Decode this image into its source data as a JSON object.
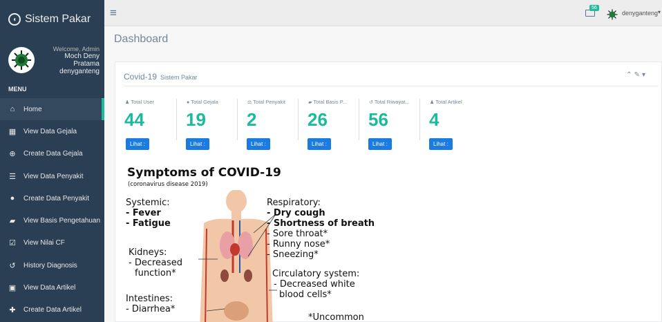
{
  "app": {
    "brand": "Sistem Pakar"
  },
  "profile": {
    "welcome": "Welcome, Admin",
    "name": "Moch Deny Pratama",
    "username": "denyganteng"
  },
  "sidebar": {
    "menu_header": "MENU",
    "items": [
      {
        "label": "Home",
        "icon": "home-icon"
      },
      {
        "label": "View Data Gejala",
        "icon": "table-icon"
      },
      {
        "label": "Create Data Gejala",
        "icon": "search-plus-icon"
      },
      {
        "label": "View Data Penyakit",
        "icon": "database-icon"
      },
      {
        "label": "Create Data Penyakit",
        "icon": "plus-circle-icon"
      },
      {
        "label": "View Basis Pengetahuan",
        "icon": "book-icon"
      },
      {
        "label": "View Nilai CF",
        "icon": "calendar-check-icon"
      },
      {
        "label": "History Diagnosis",
        "icon": "history-icon"
      },
      {
        "label": "View Data Artikel",
        "icon": "image-icon"
      },
      {
        "label": "Create Data Artikel",
        "icon": "plus-icon"
      }
    ]
  },
  "topnav": {
    "mail_count": "56",
    "username": "denyganteng"
  },
  "page": {
    "title": "Dashboard"
  },
  "panel": {
    "title": "Covid-19",
    "subtitle": "Sistem Pakar"
  },
  "stats": [
    {
      "label": "Total User",
      "value": "44",
      "button": "Lihat :",
      "icon": "user-icon"
    },
    {
      "label": "Total Gejala",
      "value": "19",
      "button": "Lihat :",
      "icon": "comments-icon"
    },
    {
      "label": "Total Penyakit",
      "value": "2",
      "button": "Lihat :",
      "icon": "balance-scale-icon"
    },
    {
      "label": "Total Basis P...",
      "value": "26",
      "button": "Lihat :",
      "icon": "book-icon"
    },
    {
      "label": "Total Riwayat...",
      "value": "56",
      "button": "Lihat :",
      "icon": "history-icon"
    },
    {
      "label": "Total Artikel",
      "value": "4",
      "button": "Lihat :",
      "icon": "user-icon"
    }
  ],
  "infographic": {
    "title": "Symptoms of COVID-19",
    "subtitle": "(coronavirus disease 2019)",
    "systemic": {
      "heading": "Systemic:",
      "items": [
        "- Fever",
        "- Fatigue"
      ]
    },
    "respiratory": {
      "heading": "Respiratory:",
      "bold_items": [
        "- Dry cough",
        "- Shortness of breath"
      ],
      "items": [
        "- Sore throat*",
        "- Runny nose*",
        "- Sneezing*"
      ]
    },
    "kidneys": {
      "heading": "Kidneys:",
      "items": [
        "- Decreased",
        "function*"
      ]
    },
    "circulatory": {
      "heading": "Circulatory system:",
      "items": [
        "- Decreased white",
        "blood cells*"
      ]
    },
    "intestines": {
      "heading": "Intestines:",
      "items": [
        "- Diarrhea*"
      ]
    },
    "footnote": "*Uncommon"
  }
}
